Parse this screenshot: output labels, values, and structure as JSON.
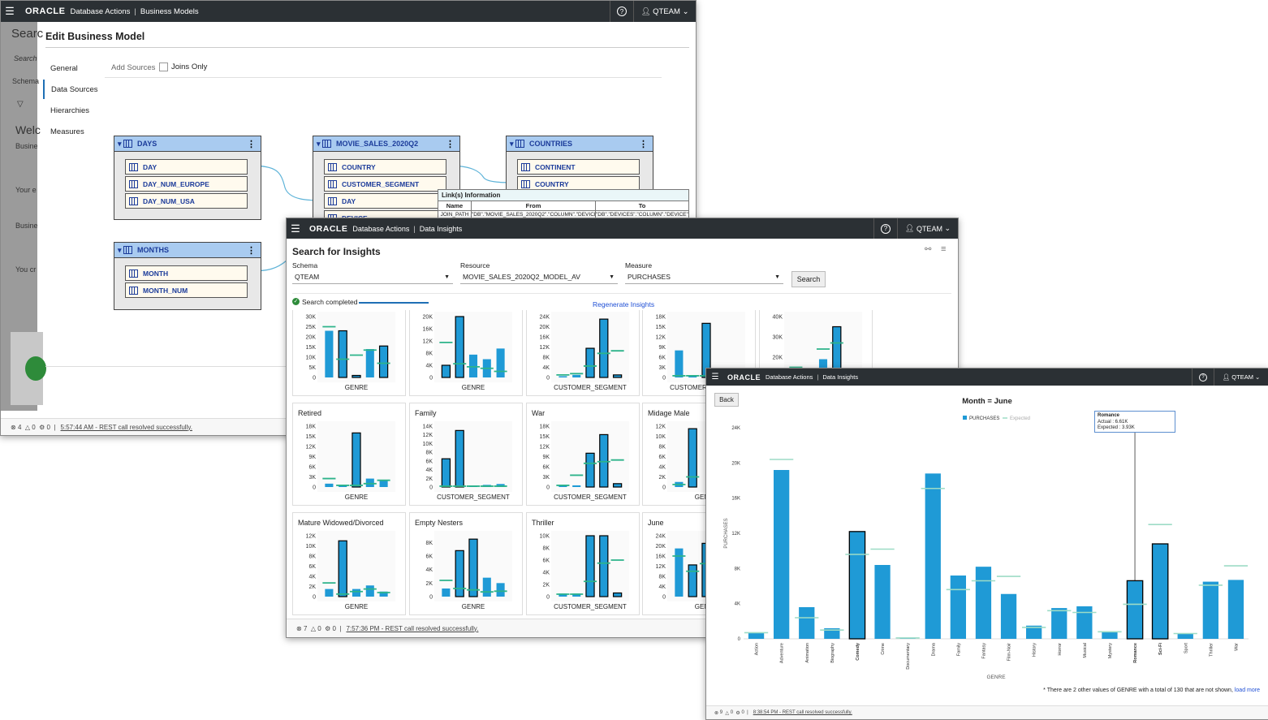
{
  "win1": {
    "brand": "ORACLE",
    "app": "Database Actions",
    "page": "Business Models",
    "user": "QTEAM",
    "help": "?",
    "background_text": [
      "Searc",
      "Search",
      "Schema",
      "S",
      "Welc",
      "Busine",
      "Your e",
      "Busine",
      "You cr"
    ],
    "dialog_title": "Edit Business Model",
    "nav": [
      "General",
      "Data Sources",
      "Hierarchies",
      "Measures"
    ],
    "add_sources": "Add Sources",
    "joins_only": "Joins Only",
    "nodes": [
      {
        "name": "DAYS",
        "cols": [
          "DAY",
          "DAY_NUM_EUROPE",
          "DAY_NUM_USA"
        ]
      },
      {
        "name": "MOVIE_SALES_2020Q2",
        "cols": [
          "COUNTRY",
          "CUSTOMER_SEGMENT",
          "DAY",
          "DEVICE"
        ]
      },
      {
        "name": "COUNTRIES",
        "cols": [
          "CONTINENT",
          "COUNTRY"
        ]
      },
      {
        "name": "MONTHS",
        "cols": [
          "MONTH",
          "MONTH_NUM"
        ]
      }
    ],
    "link_info": {
      "title": "Link(s) Information",
      "headers": [
        "Name",
        "From",
        "To"
      ],
      "row": [
        "JOIN_PATH",
        "\"DB\".\"MOVIE_SALES_2020Q2\".\"COLUMN\".\"DEVICE\"",
        "\"DB\".\"DEVICES\".\"COLUMN\".\"DEVICE\""
      ]
    },
    "status": {
      "errors": "4",
      "warnings": "0",
      "other": "0",
      "msg": "5:57:44 AM - REST call resolved successfully."
    }
  },
  "win2": {
    "brand": "ORACLE",
    "app": "Database Actions",
    "page": "Data Insights",
    "user": "QTEAM",
    "help": "?",
    "title": "Search for Insights",
    "schema_label": "Schema",
    "schema_value": "QTEAM",
    "resource_label": "Resource",
    "resource_value": "MOVIE_SALES_2020Q2_MODEL_AV",
    "measure_label": "Measure",
    "measure_value": "PURCHASES",
    "search_button": "Search",
    "search_completed": "Search completed",
    "regenerate": "Regenerate Insights",
    "status": {
      "errors": "7",
      "warnings": "0",
      "other": "0",
      "msg": "7:57:36 PM - REST call resolved successfully."
    }
  },
  "chart_data_cards": [
    {
      "title": "",
      "xlabel": "GENRE",
      "ticks": [
        "0",
        "5K",
        "10K",
        "15K",
        "20K",
        "25K",
        "30K"
      ],
      "max": 30000,
      "values": [
        23000,
        23000,
        1000,
        14000,
        15500
      ],
      "expected": [
        25000,
        9000,
        11000,
        13500,
        7000
      ],
      "outlined": [
        1,
        2,
        4
      ]
    },
    {
      "title": "",
      "xlabel": "GENRE",
      "ticks": [
        "0",
        "4K",
        "8K",
        "12K",
        "16K",
        "20K"
      ],
      "max": 20000,
      "values": [
        4000,
        20000,
        7500,
        6000,
        9500
      ],
      "expected": [
        11500,
        4500,
        3500,
        3000,
        2000
      ],
      "outlined": [
        0,
        1
      ]
    },
    {
      "title": "",
      "xlabel": "CUSTOMER_SEGMENT",
      "ticks": [
        "0",
        "4K",
        "8K",
        "12K",
        "16K",
        "20K",
        "24K"
      ],
      "max": 24000,
      "values": [
        500,
        1000,
        11500,
        23000,
        1000
      ],
      "expected": [
        1000,
        1500,
        4500,
        9500,
        10500
      ],
      "outlined": [
        2,
        3,
        4
      ]
    },
    {
      "title": "",
      "xlabel": "CUSTOMER_SEGMENT",
      "ticks": [
        "0",
        "3K",
        "6K",
        "9K",
        "12K",
        "15K",
        "18K"
      ],
      "max": 18000,
      "values": [
        8000,
        500,
        16000
      ],
      "expected": [
        500,
        500,
        500
      ],
      "outlined": [
        2
      ]
    },
    {
      "title": "",
      "xlabel": "",
      "ticks": [
        "10K",
        "20K",
        "30K",
        "40K"
      ],
      "max": 40000,
      "values": [
        0,
        0,
        19000,
        35000
      ],
      "expected": [
        15000,
        14000,
        24000,
        27000
      ],
      "outlined": [
        3
      ]
    },
    {
      "title": "Retired",
      "xlabel": "GENRE",
      "ticks": [
        "0",
        "3K",
        "6K",
        "9K",
        "12K",
        "15K",
        "18K"
      ],
      "max": 18000,
      "values": [
        1000,
        500,
        16000,
        2500,
        2000
      ],
      "expected": [
        2500,
        500,
        500,
        1000,
        2000
      ],
      "outlined": [
        2
      ]
    },
    {
      "title": "Family",
      "xlabel": "CUSTOMER_SEGMENT",
      "ticks": [
        "0",
        "2K",
        "4K",
        "6K",
        "8K",
        "10K",
        "12K",
        "14K"
      ],
      "max": 14000,
      "values": [
        6500,
        13000,
        300,
        500,
        700
      ],
      "expected": [
        200,
        200,
        200,
        200,
        200
      ],
      "outlined": [
        0,
        1
      ]
    },
    {
      "title": "War",
      "xlabel": "CUSTOMER_SEGMENT",
      "ticks": [
        "0",
        "3K",
        "6K",
        "9K",
        "12K",
        "15K",
        "18K"
      ],
      "max": 18000,
      "values": [
        500,
        500,
        10000,
        15500,
        1000
      ],
      "expected": [
        500,
        3500,
        7000,
        7500,
        8000
      ],
      "outlined": [
        2,
        3,
        4
      ]
    },
    {
      "title": "Midage Male",
      "xlabel": "GENRE",
      "ticks": [
        "0",
        "2K",
        "4K",
        "6K",
        "8K",
        "10K",
        "12K"
      ],
      "max": 12000,
      "values": [
        1000,
        11500
      ],
      "expected": [
        500,
        2000
      ],
      "outlined": [
        1
      ]
    },
    {
      "title": "Mature Widowed/Divorced",
      "xlabel": "GENRE",
      "ticks": [
        "0",
        "2K",
        "4K",
        "6K",
        "8K",
        "10K",
        "12K"
      ],
      "max": 12000,
      "values": [
        1500,
        11000,
        1500,
        2200,
        1000
      ],
      "expected": [
        2700,
        500,
        1000,
        1500,
        800
      ],
      "outlined": [
        1
      ]
    },
    {
      "title": "Empty Nesters",
      "xlabel": "GENRE",
      "ticks": [
        "0",
        "2K",
        "4K",
        "6K",
        "8K"
      ],
      "max": 9000,
      "values": [
        1200,
        6800,
        8500,
        2800,
        2000
      ],
      "expected": [
        2400,
        1200,
        1000,
        700,
        800
      ],
      "outlined": [
        1,
        2
      ]
    },
    {
      "title": "Thriller",
      "xlabel": "CUSTOMER_SEGMENT",
      "ticks": [
        "0",
        "2K",
        "4K",
        "6K",
        "8K",
        "10K"
      ],
      "max": 10000,
      "values": [
        500,
        500,
        10000,
        10000,
        600
      ],
      "expected": [
        400,
        400,
        2500,
        5500,
        6000
      ],
      "outlined": [
        2,
        3,
        4
      ]
    },
    {
      "title": "June",
      "xlabel": "GENRE",
      "ticks": [
        "0",
        "4K",
        "8K",
        "12K",
        "16K",
        "20K",
        "24K"
      ],
      "max": 24000,
      "values": [
        19000,
        12500,
        21000
      ],
      "expected": [
        16000,
        10000,
        13000
      ],
      "outlined": [
        1,
        2
      ]
    }
  ],
  "win3": {
    "brand": "ORACLE",
    "app": "Database Actions",
    "page": "Data Insights",
    "user": "QTEAM",
    "help": "?",
    "back_button": "Back",
    "footnote": "* There are 2 other values of GENRE with a total of 130 that are not shown,",
    "load_more": "load more",
    "tooltip": {
      "title": "Romance",
      "actual": "Actual : 6.61K",
      "expected": "Expected : 3.93K"
    },
    "status": {
      "errors": "9",
      "warnings": "0",
      "other": "0",
      "msg": "8:38:54 PM - REST call resolved successfully."
    }
  },
  "chart_data": {
    "type": "bar",
    "title": "Month = June",
    "xlabel": "GENRE",
    "ylabel": "PURCHASES",
    "ylim": [
      0,
      24000
    ],
    "ticks": [
      "0",
      "4K",
      "8K",
      "12K",
      "16K",
      "20K",
      "24K"
    ],
    "categories": [
      "Action",
      "Adventure",
      "Animation",
      "Biography",
      "Comedy",
      "Crime",
      "Documentary",
      "Drama",
      "Family",
      "Fantasy",
      "Film-Noir",
      "History",
      "Horror",
      "Musical",
      "Mystery",
      "Romance",
      "Sci-Fi",
      "Sport",
      "Thriller",
      "War"
    ],
    "series": [
      {
        "name": "PURCHASES",
        "values": [
          700,
          19200,
          3600,
          1200,
          12200,
          8400,
          100,
          18800,
          7200,
          8200,
          5100,
          1500,
          3500,
          3700,
          800,
          6610,
          10800,
          600,
          6500,
          6700
        ]
      },
      {
        "name": "Expected",
        "values": [
          700,
          20400,
          2400,
          1000,
          9600,
          10200,
          100,
          17100,
          5600,
          6600,
          7100,
          1300,
          3200,
          3000,
          800,
          3930,
          13000,
          600,
          6100,
          8300
        ]
      }
    ],
    "highlighted": [
      "Comedy",
      "Romance",
      "Sci-Fi"
    ],
    "legend": [
      "PURCHASES",
      "Expected"
    ],
    "legend_position": "top"
  }
}
